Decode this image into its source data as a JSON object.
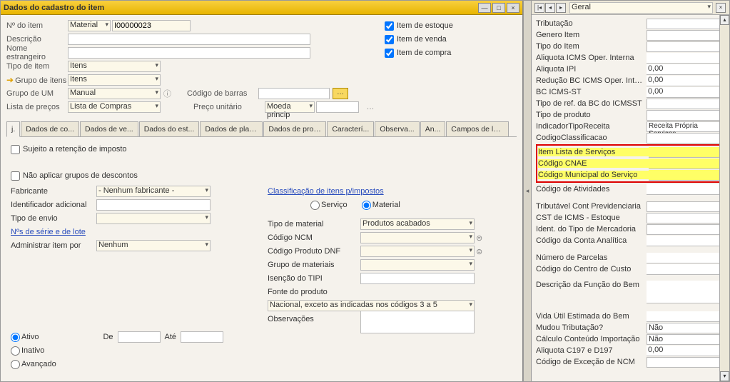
{
  "window": {
    "title": "Dados do cadastro do item"
  },
  "header": {
    "item_no_lbl": "Nº do item",
    "item_type": "Material",
    "item_no": "I00000023",
    "desc_lbl": "Descrição",
    "desc": "",
    "foreign_lbl": "Nome estrangeiro",
    "foreign": "",
    "type_lbl": "Tipo de item",
    "type": "Itens",
    "group_lbl": "Grupo de itens",
    "group": "Itens",
    "umgrp_lbl": "Grupo de UM",
    "umgrp": "Manual",
    "pricelist_lbl": "Lista de preços",
    "pricelist": "Lista de Compras",
    "barcode_lbl": "Código de barras",
    "barcode": "",
    "unitprice_lbl": "Preço unitário",
    "currency": "Moeda princip",
    "price": "",
    "chk_stock": "Item de estoque",
    "chk_sales": "Item de venda",
    "chk_purch": "Item de compra"
  },
  "tabs": [
    "j.",
    "Dados de co...",
    "Dados de ve...",
    "Dados do est...",
    "Dados de planejam...",
    "Dados de prod...",
    "Caracterí...",
    "Observa...",
    "An...",
    "Campos de localiz..."
  ],
  "taxtab": {
    "retention": "Sujeito a retenção de imposto",
    "nodiscount": "Não aplicar grupos de descontos",
    "fabricante_lbl": "Fabricante",
    "fabricante": "- Nenhum fabricante -",
    "idadc_lbl": "Identificador adicional",
    "idadc": "",
    "envio_lbl": "Tipo de envio",
    "envio": "",
    "series_link": "Nºs de série e de lote",
    "admin_lbl": "Administrar item por",
    "admin": "Nenhum",
    "class_link": "Classificação de itens p/impostos",
    "r_servico": "Serviço",
    "r_material": "Material",
    "tipomaterial_lbl": "Tipo de material",
    "tipomaterial": "Produtos acabados",
    "ncm_lbl": "Código NCM",
    "ncm": "",
    "dnf_lbl": "Código Produto DNF",
    "dnf": "",
    "grpmat_lbl": "Grupo de materiais",
    "grpmat": "",
    "tipi_lbl": "Isenção do TIPI",
    "tipi": "",
    "fonte_lbl": "Fonte do produto",
    "fonte": "Nacional, exceto as indicadas nos códigos 3 a 5",
    "obs_lbl": "Observações",
    "obs": "",
    "ativo": "Ativo",
    "inativo": "Inativo",
    "avanc": "Avançado",
    "de": "De",
    "ate": "Até"
  },
  "right": {
    "panel": "Geral",
    "labels": {
      "tributacao": "Tributação",
      "genero": "Genero Item",
      "tipo": "Tipo do Item",
      "aliq_icms": "Aliquota ICMS Oper. Interna",
      "aliq_ipi": "Aliquota IPI",
      "red_bc": "Redução BC ICMS Oper. Interna",
      "bc_st": "BC ICMS-ST",
      "tiporef": "Tipo de ref. da BC do ICMSST",
      "tipoprod": "Tipo de produto",
      "indrec": "IndicadorTipoReceita",
      "codclass": "CodigoClassificacao",
      "itemlista": "Item Lista de Serviços",
      "cnae": "Código CNAE",
      "codmuni": "Código Municipal do Serviço",
      "codativ": "Código de Atividades",
      "tribcont": "Tributável Cont Previdenciaria",
      "cst": "CST  de ICMS - Estoque",
      "idmerc": "Ident. do Tipo de Mercadoria",
      "codconta": "Código da Conta Analítica",
      "numparc": "Número de Parcelas",
      "codcentro": "Código do Centro de Custo",
      "descfunc": "Descrição da Função do Bem",
      "vidautil": "Vida Útil Estimada do Bem",
      "mudou": "Mudou Tributação?",
      "calcimp": "Cálculo Conteúdo Importação",
      "aliqc197": "Aliquota C197 e D197",
      "codexc": "Código de Exceção de NCM"
    },
    "values": {
      "aliq_ipi": "0,00",
      "red_bc": "0,00",
      "bc_st": "0,00",
      "indrec": "Receita Própria  Serviços",
      "mudou": "Não",
      "calcimp": "Não",
      "aliqc197": "0,00"
    }
  }
}
